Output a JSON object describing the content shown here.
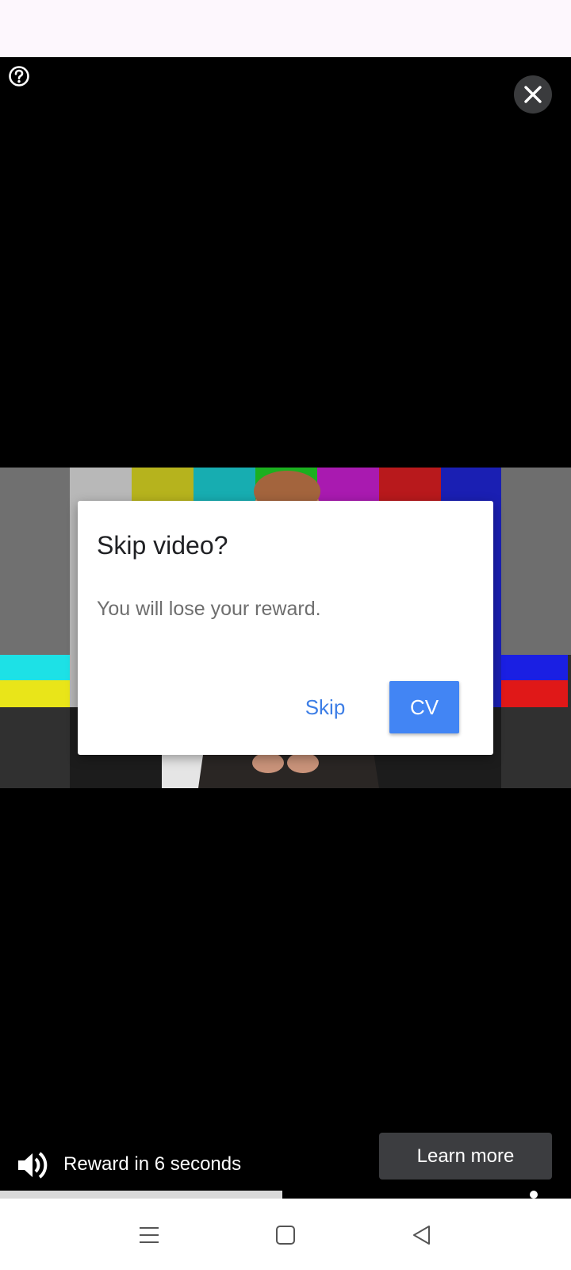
{
  "dialog": {
    "title": "Skip video?",
    "message": "You will lose your reward.",
    "skip_label": "Skip",
    "continue_label": "CV"
  },
  "ad": {
    "reward_text": "Reward in 6 seconds",
    "learn_more_label": "Learn more",
    "progress": 0.495
  },
  "icons": {
    "help": "help-icon",
    "close": "close-icon",
    "volume": "volume-icon",
    "menu": "menu-icon",
    "home": "home-icon",
    "back": "back-icon"
  },
  "colors": {
    "accent": "#4285f4",
    "skip_text": "#3d7ee6",
    "status_bar": "#fdf7fd",
    "learn_more_bg": "#3c3d40"
  }
}
